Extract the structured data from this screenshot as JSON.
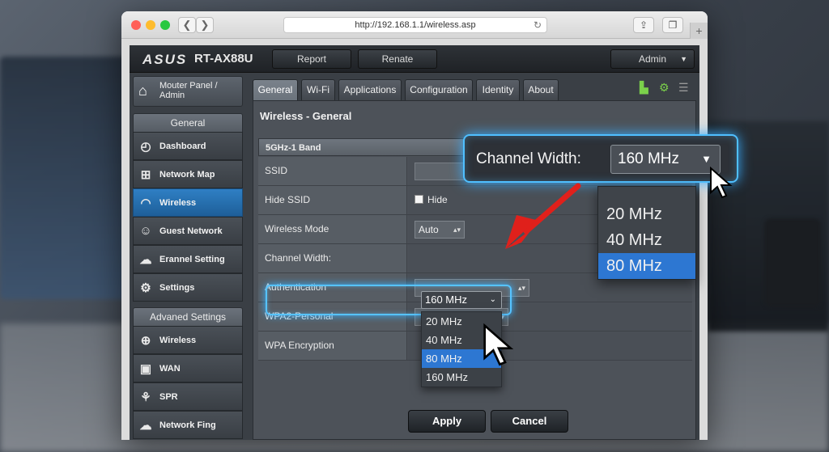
{
  "browser": {
    "url": "http://192.168.1.1/wireless.asp",
    "back_glyph": "❮",
    "forward_glyph": "❯",
    "reload_glyph": "↻",
    "share_glyph": "⇪",
    "tabs_glyph": "❐",
    "newtab_glyph": "+"
  },
  "router": {
    "brand": "ASUS",
    "model": "RT-AX88U",
    "header_buttons": {
      "report": "Report",
      "renate": "Renate",
      "admin": "Admin"
    },
    "panel_button": {
      "line1": "Mouter Panel /",
      "line2": "Admin"
    },
    "sections": {
      "general": "General",
      "advanced": "Advaned Settings"
    },
    "general_items": [
      {
        "label": "Dashboard",
        "icon": "gauge-icon"
      },
      {
        "label": "Network Map",
        "icon": "network-map-icon"
      },
      {
        "label": "Wireless",
        "icon": "wifi-icon"
      },
      {
        "label": "Guest Network",
        "icon": "users-icon"
      },
      {
        "label": "Erannel Setting",
        "icon": "cloud-lock-icon"
      },
      {
        "label": "Settings",
        "icon": "gear-icon"
      }
    ],
    "advanced_items": [
      {
        "label": "Wireless",
        "icon": "globe-icon"
      },
      {
        "label": "WAN",
        "icon": "wan-icon"
      },
      {
        "label": "SPR",
        "icon": "spr-icon"
      },
      {
        "label": "Network Fing",
        "icon": "cloud-network-icon"
      }
    ],
    "tabs": [
      "General",
      "Wi-Fi",
      "Applications",
      "Configuration",
      "Identity",
      "About"
    ],
    "page_title": "Wireless - General",
    "band_header": "5GHz-1 Band",
    "rows": {
      "ssid": "SSID",
      "hide_ssid": "Hide SSID",
      "hide_label": "Hide",
      "wireless_mode": "Wireless Mode",
      "wireless_mode_value": "Auto",
      "channel_width": "Channel Width:",
      "channel_width_value": "160 MHz",
      "authentication": "Authentication",
      "wpa2_personal": "WPA2-Personal",
      "wpa_encryption": "WPA Encryption"
    },
    "channel_width_options": [
      "20 MHz",
      "40 MHz",
      "80 MHz",
      "160 MHz"
    ],
    "highlighted_option": "80 MHz",
    "buttons": {
      "apply": "Apply",
      "cancel": "Cancel"
    }
  },
  "callout": {
    "label": "Channel Width:",
    "value": "160 MHz",
    "options": [
      "20 MHz",
      "40 MHz",
      "80 MHz"
    ],
    "highlighted_option": "80 MHz"
  },
  "colors": {
    "accent_blue": "#2d77d2",
    "glow_blue": "#4fbfff",
    "arrow_red": "#e0201b",
    "tool_green": "#7bd14b"
  }
}
